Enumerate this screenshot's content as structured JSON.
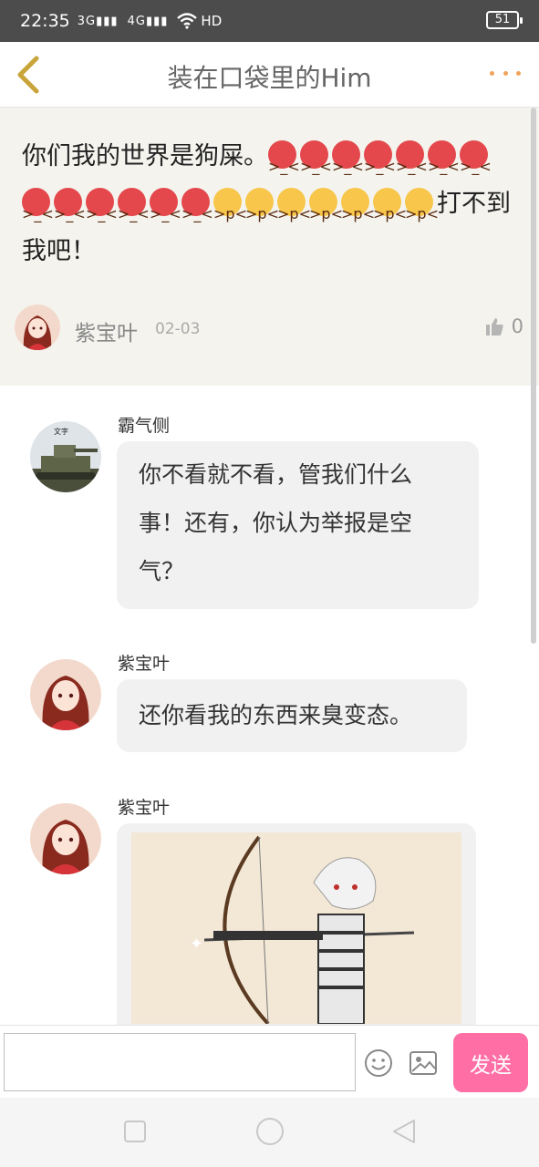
{
  "status_bar": {
    "time": "22:35",
    "signal_1": "3G",
    "signal_2": "4G",
    "hd": "HD",
    "battery": "51"
  },
  "header": {
    "title": "装在口袋里的Him",
    "back_icon": "chevron-left-icon",
    "more_icon": "more-dots-icon"
  },
  "post": {
    "text_part1": "你们我的世界是狗屎。",
    "text_part2": "打不到我吧！",
    "author": "紫宝叶",
    "date": "02-03",
    "like_count": "0",
    "angry_emoji_count": 13,
    "tongue_emoji_count": 7
  },
  "comments": [
    {
      "name": "霸气侧",
      "text": "你不看就不看，管我们什么事！还有，你认为举报是空气？"
    },
    {
      "name": "紫宝叶",
      "text": "还你看我的东西来臭变态。"
    },
    {
      "name": "紫宝叶"
    }
  ],
  "composer": {
    "placeholder": "",
    "send_label": "发送",
    "emoji_icon": "smiley-icon",
    "image_icon": "image-icon"
  },
  "colors": {
    "accent": "#ff6fa5",
    "back_arrow": "#c9a43a",
    "more_dots": "#f0a35a",
    "post_bg": "#f4f3ee"
  }
}
